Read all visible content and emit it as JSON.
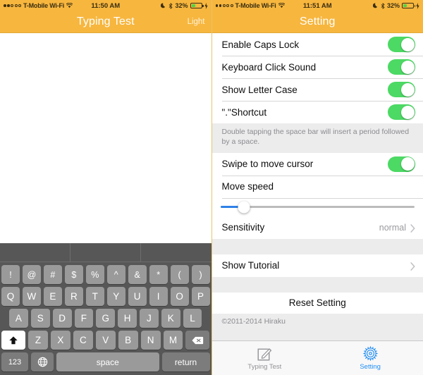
{
  "left": {
    "statusbar": {
      "carrier": "T-Mobile Wi-Fi",
      "time": "11:50 AM",
      "battery_percent": "32%",
      "signal_dots_filled": 2,
      "signal_dots_total": 5,
      "icons": [
        "wifi-icon",
        "moon-icon",
        "bluetooth-icon",
        "battery-icon",
        "charging-bolt-icon"
      ]
    },
    "navbar": {
      "title": "Typing Test",
      "right_button": "Light"
    },
    "keyboard": {
      "suggestion_slots": [
        "",
        "",
        ""
      ],
      "rows": {
        "symbols": [
          "!",
          "@",
          "#",
          "$",
          "%",
          "^",
          "&",
          "*",
          "(",
          ")"
        ],
        "top": [
          "Q",
          "W",
          "E",
          "R",
          "T",
          "Y",
          "U",
          "I",
          "O",
          "P"
        ],
        "home": [
          "A",
          "S",
          "D",
          "F",
          "G",
          "H",
          "J",
          "K",
          "L"
        ],
        "bottom": [
          "Z",
          "X",
          "C",
          "V",
          "B",
          "N",
          "M"
        ]
      },
      "shift_key": "shift-icon",
      "delete_key": "delete-icon",
      "numeric_key": "123",
      "globe_key": "globe-icon",
      "space_key": "space",
      "return_key": "return",
      "shift_active": true
    }
  },
  "right": {
    "statusbar": {
      "carrier": "T-Mobile Wi-Fi",
      "time": "11:51 AM",
      "battery_percent": "32%",
      "signal_dots_filled": 2,
      "signal_dots_total": 5
    },
    "navbar": {
      "title": "Setting"
    },
    "settings": {
      "group1": [
        {
          "label": "Enable Caps Lock",
          "type": "toggle",
          "value": "on"
        },
        {
          "label": "Keyboard Click Sound",
          "type": "toggle",
          "value": "on"
        },
        {
          "label": "Show Letter Case",
          "type": "toggle",
          "value": "on"
        },
        {
          "label": "\".\"Shortcut",
          "type": "toggle",
          "value": "on"
        }
      ],
      "footnote": "Double tapping the space bar will insert a period followed by a space.",
      "group2": [
        {
          "label": "Swipe to move cursor",
          "type": "toggle",
          "value": "on"
        },
        {
          "label": "Move speed",
          "type": "label"
        }
      ],
      "slider": {
        "name": "move-speed-slider",
        "percent": 12
      },
      "group3": [
        {
          "label": "Sensitivity",
          "type": "disclosure",
          "value": "normal"
        }
      ],
      "group4": [
        {
          "label": "Show Tutorial",
          "type": "disclosure",
          "value": ""
        }
      ],
      "reset_label": "Reset Setting",
      "copyright": "©2011-2014 Hiraku"
    },
    "tabbar": {
      "tabs": [
        {
          "label": "Typing Test",
          "icon": "compose-icon",
          "active": false
        },
        {
          "label": "Setting",
          "icon": "gear-icon",
          "active": true
        }
      ]
    }
  },
  "colors": {
    "accent_orange": "#f7b63e",
    "toggle_green": "#4cd964",
    "slider_blue": "#2f81e8",
    "tab_active_blue": "#1f8df5"
  }
}
